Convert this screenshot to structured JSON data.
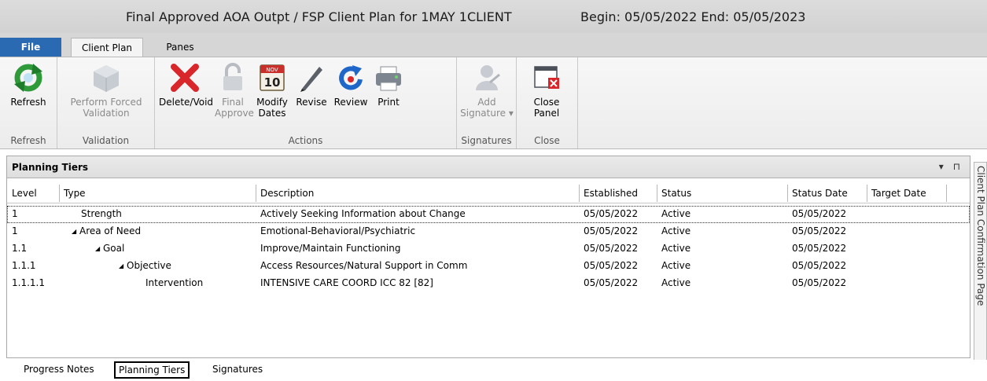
{
  "window": {
    "title": "Final Approved AOA Outpt / FSP Client Plan for 1MAY 1CLIENT",
    "dates": "Begin: 05/05/2022 End: 05/05/2023"
  },
  "menu_tabs": {
    "file": "File",
    "client_plan": "Client Plan",
    "panes": "Panes"
  },
  "ribbon": {
    "refresh": {
      "label": "Refresh",
      "group": "Refresh"
    },
    "validation": {
      "label": "Perform Forced\nValidation",
      "group": "Validation"
    },
    "actions": {
      "group": "Actions",
      "delete": "Delete/Void",
      "final_approve": "Final\nApprove",
      "modify_dates": "Modify\nDates",
      "revise": "Revise",
      "review": "Review",
      "print": "Print"
    },
    "signatures": {
      "label": "Add\nSignature ▾",
      "group": "Signatures"
    },
    "close": {
      "label": "Close\nPanel",
      "group": "Close"
    },
    "calendar_number": "10",
    "calendar_month": "NOV"
  },
  "panel": {
    "title": "Planning Tiers",
    "controls": "▾ ⊓",
    "columns": [
      "Level",
      "Type",
      "Description",
      "Established",
      "Status",
      "Status Date",
      "Target Date"
    ],
    "rows": [
      {
        "level": "1",
        "type": "Strength",
        "expander": "",
        "description": "Actively Seeking Information about Change",
        "established": "05/05/2022",
        "status": "Active",
        "status_date": "05/05/2022",
        "target_date": ""
      },
      {
        "level": "1",
        "type": "Area of Need",
        "expander": "◢",
        "description": "Emotional-Behavioral/Psychiatric",
        "established": "05/05/2022",
        "status": "Active",
        "status_date": "05/05/2022",
        "target_date": ""
      },
      {
        "level": "1.1",
        "type": "Goal",
        "expander": "◢",
        "description": "Improve/Maintain Functioning",
        "established": "05/05/2022",
        "status": "Active",
        "status_date": "05/05/2022",
        "target_date": ""
      },
      {
        "level": "1.1.1",
        "type": "Objective",
        "expander": "◢",
        "description": "Access Resources/Natural Support in Comm",
        "established": "05/05/2022",
        "status": "Active",
        "status_date": "05/05/2022",
        "target_date": ""
      },
      {
        "level": "1.1.1.1",
        "type": "Intervention",
        "expander": "",
        "description": "INTENSIVE CARE COORD ICC 82 [82]",
        "established": "05/05/2022",
        "status": "Active",
        "status_date": "05/05/2022",
        "target_date": ""
      }
    ]
  },
  "side_tab": "Client Plan Confirmation Page",
  "bottom_tabs": [
    "Progress Notes",
    "Planning Tiers",
    "Signatures"
  ],
  "colors": {
    "file_tab": "#2a6ab3",
    "delete_red": "#d9262a",
    "title_bg": "#d6d6d6"
  }
}
